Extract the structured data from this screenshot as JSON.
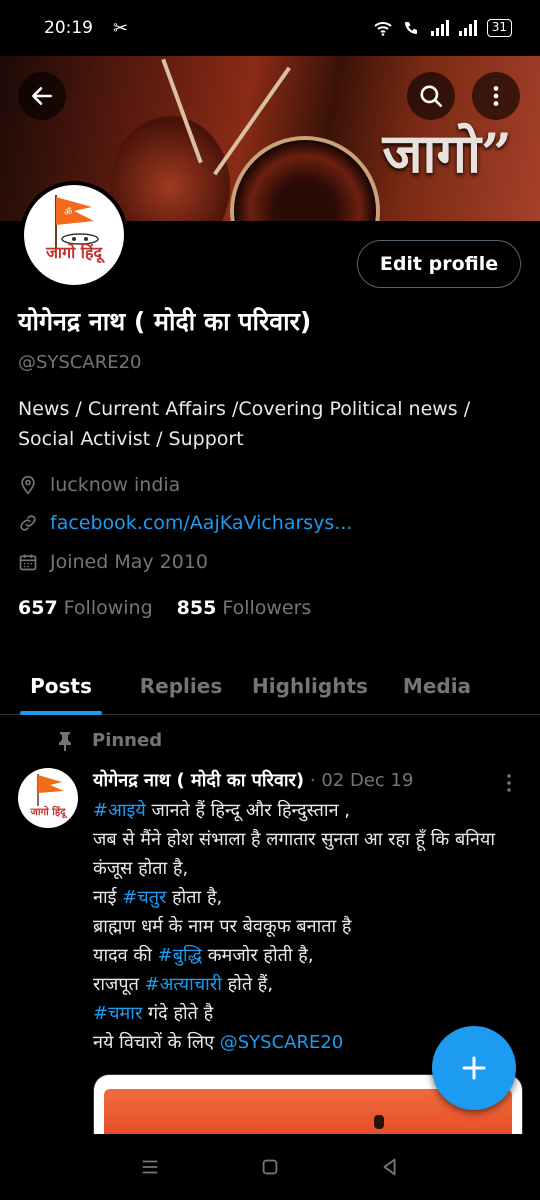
{
  "status_bar": {
    "time": "20:19",
    "battery": "31"
  },
  "banner": {
    "text": "जागो”"
  },
  "profile": {
    "avatar_text": "जागो हिंदू",
    "edit_label": "Edit profile",
    "display_name": "योगेनद्र नाथ ( मोदी का परिवार)",
    "handle": "@SYSCARE20",
    "bio": "News / Current Affairs /Covering Political news / Social Activist / Support",
    "location": "lucknow india",
    "link": "facebook.com/AajKaVicharsys...",
    "joined": "Joined May 2010",
    "following_count": "657",
    "following_label": "Following",
    "followers_count": "855",
    "followers_label": "Followers"
  },
  "tabs": [
    {
      "label": "Posts",
      "active": true
    },
    {
      "label": "Replies",
      "active": false
    },
    {
      "label": "Highlights",
      "active": false
    },
    {
      "label": "Media",
      "active": false
    }
  ],
  "post": {
    "pinned_label": "Pinned",
    "author": "योगेनद्र नाथ ( मोदी का परिवार)",
    "date": "· 02 Dec 19",
    "avatar_text": "जागो हिंदू",
    "lines": [
      {
        "tag": "#आइये",
        "text": " जानते हैं हिन्दू और हिन्दुस्तान ,"
      },
      {
        "tag": "",
        "text": "जब से मैंने होश संभाला है लगातार सुनता आ रहा हूँ कि बनिया कंजूस होता है,"
      },
      {
        "tag": "",
        "text": "नाई ",
        "tag2": "#चतुर",
        "text2": " होता है,"
      },
      {
        "tag": "",
        "text": "ब्राह्मण धर्म के नाम पर बेवकूफ बनाता है"
      },
      {
        "tag": "",
        "text": "यादव की ",
        "tag2": "#बुद्धि",
        "text2": " कमजोर होती है,"
      },
      {
        "tag": "",
        "text": "राजपूत ",
        "tag2": "#अत्याचारी",
        "text2": " होते हैं,"
      },
      {
        "tag": "#चमार",
        "text": " गंदे होते है"
      },
      {
        "tag": "",
        "text": "नये विचारों के लिए ",
        "tag2": "@SYSCARE20",
        "text2": ""
      }
    ]
  },
  "colors": {
    "accent": "#1d9bf0",
    "muted": "#71767b",
    "background": "#000000"
  },
  "icons": [
    "back-arrow-icon",
    "search-icon",
    "more-vertical-icon",
    "location-icon",
    "link-icon",
    "calendar-icon",
    "pin-icon",
    "plus-icon",
    "menu-icon",
    "home-square-icon",
    "back-triangle-icon"
  ]
}
